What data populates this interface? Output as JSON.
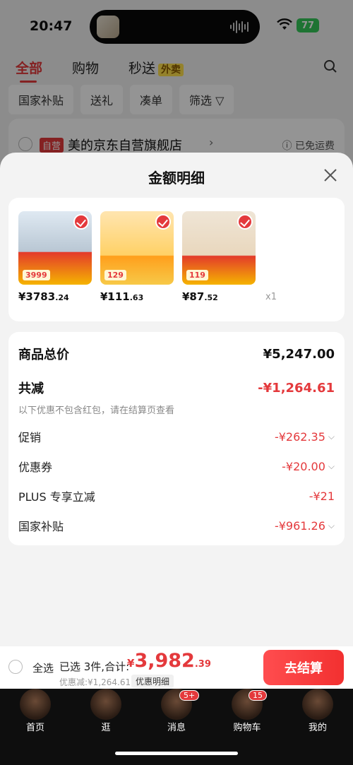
{
  "status_bar": {
    "time": "20:47",
    "battery": "77"
  },
  "background": {
    "tabs": [
      {
        "label": "全部",
        "active": true
      },
      {
        "label": "购物",
        "active": false
      },
      {
        "label": "秒送",
        "active": false,
        "tag": "外卖"
      }
    ],
    "chips": [
      "国家补贴",
      "送礼",
      "凑单",
      "筛选"
    ],
    "store": {
      "tag": "自营",
      "name": "美的京东自营旗舰店",
      "free_shipping": "已免运费"
    }
  },
  "sheet": {
    "title": "金额明细",
    "products": [
      {
        "price_int": "¥3783",
        "price_dec": ".24",
        "qty": "x1",
        "img_label": "3999"
      },
      {
        "price_int": "¥111",
        "price_dec": ".63",
        "qty": "x1",
        "img_label": "129"
      },
      {
        "price_int": "¥87",
        "price_dec": ".52",
        "qty": "x1",
        "img_label": "119"
      }
    ],
    "summary": {
      "total_label": "商品总价",
      "total_value": "¥5,247.00",
      "reduction_label": "共减",
      "reduction_value": "-¥1,264.61",
      "note": "以下优惠不包含红包，请在结算页查看",
      "items": [
        {
          "label": "促销",
          "value": "-¥262.35"
        },
        {
          "label": "优惠券",
          "value": "-¥20.00"
        },
        {
          "label": "PLUS 专享立减",
          "value": "-¥21"
        },
        {
          "label": "国家补贴",
          "value": "-¥961.26"
        }
      ]
    }
  },
  "bottom_bar": {
    "select_all": "全选",
    "selected": "已选 3件,合计:",
    "total_currency": "¥",
    "total_int": "3,982",
    "total_dec": ".39",
    "discount": "优惠减:¥1,264.61",
    "detail_link": "优惠明细",
    "checkout": "去结算"
  },
  "tabbar": [
    {
      "label": "首页",
      "badge": ""
    },
    {
      "label": "逛",
      "badge": ""
    },
    {
      "label": "消息",
      "badge": "5+"
    },
    {
      "label": "购物车",
      "badge": "15"
    },
    {
      "label": "我的",
      "badge": ""
    }
  ],
  "colors": {
    "accent": "#e4393c",
    "battery": "#34c759"
  }
}
